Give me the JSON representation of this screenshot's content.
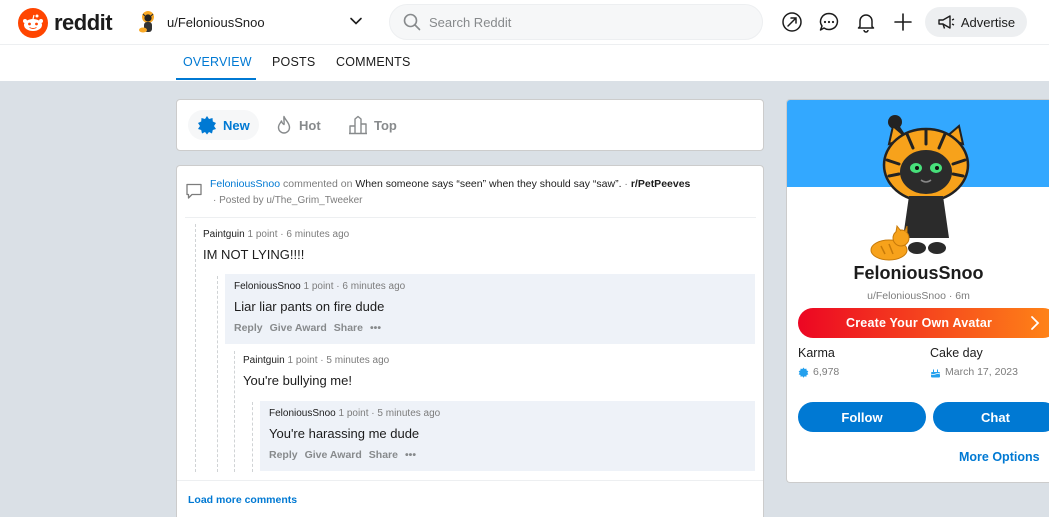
{
  "header": {
    "logo_text": "reddit",
    "current_user": "u/FeloniousSnoo",
    "search_placeholder": "Search Reddit",
    "advertise_label": "Advertise",
    "icons": [
      "popular-icon",
      "chat-icon",
      "notification-bell-icon",
      "create-post-plus-icon",
      "megaphone-icon"
    ]
  },
  "tabs": [
    {
      "label": "OVERVIEW",
      "active": true
    },
    {
      "label": "POSTS",
      "active": false
    },
    {
      "label": "COMMENTS",
      "active": false
    }
  ],
  "sort": [
    {
      "label": "New",
      "icon": "new-badge-icon",
      "active": true
    },
    {
      "label": "Hot",
      "icon": "flame-icon",
      "active": false
    },
    {
      "label": "Top",
      "icon": "top-chart-icon",
      "active": false
    }
  ],
  "context": {
    "author": "FeloniousSnoo",
    "verb": "commented on",
    "post_title": "When someone says “seen” when they should say “saw”.",
    "separator": "·",
    "subreddit": "r/PetPeeves",
    "posted_by": "· Posted by u/The_Grim_Tweeker"
  },
  "comments": [
    {
      "author": "Paintguin",
      "meta": "1 point · 6 minutes ago",
      "body": "IM NOT LYING!!!!",
      "highlighted": false
    },
    {
      "author": "FeloniousSnoo",
      "meta": "1 point · 6 minutes ago",
      "body": "Liar liar pants on fire dude",
      "highlighted": true,
      "actions": {
        "reply": "Reply",
        "award": "Give Award",
        "share": "Share",
        "more": "•••"
      }
    },
    {
      "author": "Paintguin",
      "meta": "1 point · 5 minutes ago",
      "body": "You're bullying me!",
      "highlighted": false
    },
    {
      "author": "FeloniousSnoo",
      "meta": "1 point · 5 minutes ago",
      "body": "You're harassing me dude",
      "highlighted": true,
      "actions": {
        "reply": "Reply",
        "award": "Give Award",
        "share": "Share",
        "more": "•••"
      }
    }
  ],
  "load_more": "Load more comments",
  "profile": {
    "display_name": "FeloniousSnoo",
    "handle": "u/FeloniousSnoo · 6m",
    "create_avatar": "Create Your Own Avatar",
    "karma_label": "Karma",
    "karma_value": "6,978",
    "cakeday_label": "Cake day",
    "cakeday_value": "March 17, 2023",
    "follow": "Follow",
    "chat": "Chat",
    "more_options": "More Options"
  },
  "colors": {
    "accent": "#0079d3",
    "reddit_orange": "#ff4500",
    "banner": "#33a8ff",
    "page_bg": "#dae0e6"
  }
}
